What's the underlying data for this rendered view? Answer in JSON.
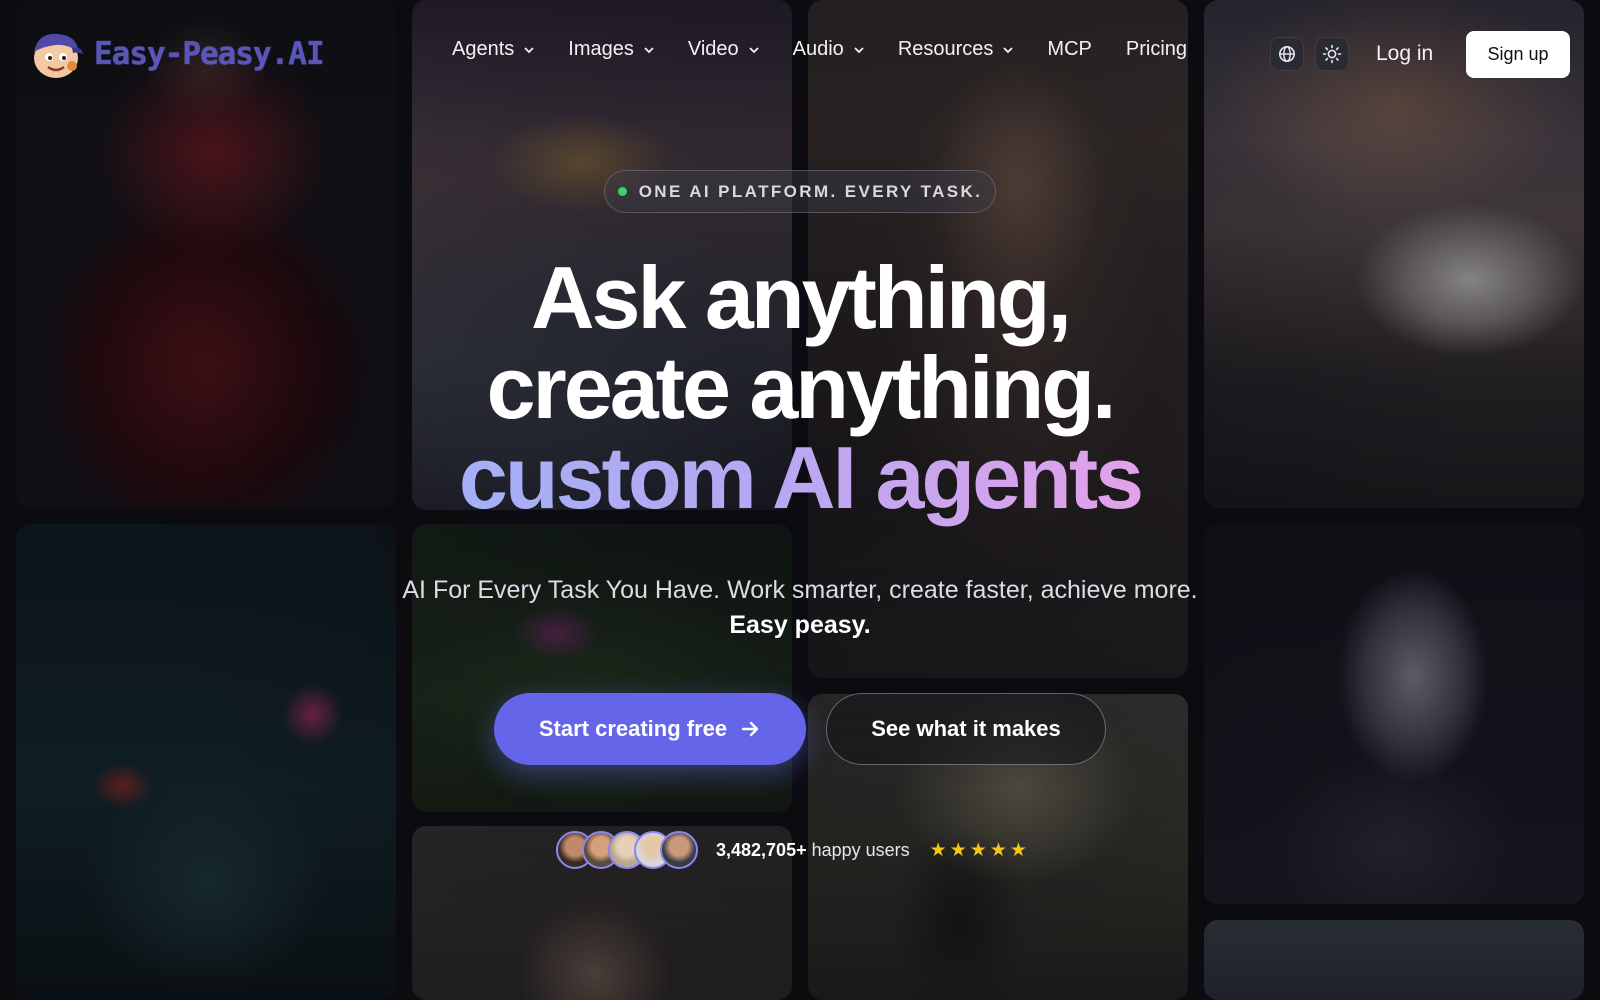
{
  "brand": {
    "name": "Easy-Peasy.AI"
  },
  "nav": {
    "menu": [
      {
        "label": "Agents",
        "dropdown": true
      },
      {
        "label": "Images",
        "dropdown": true
      },
      {
        "label": "Video",
        "dropdown": true
      },
      {
        "label": "Audio",
        "dropdown": true
      },
      {
        "label": "Resources",
        "dropdown": true
      },
      {
        "label": "MCP",
        "dropdown": false
      },
      {
        "label": "Pricing",
        "dropdown": false
      }
    ],
    "icons": [
      "globe-icon",
      "sun-icon"
    ],
    "login_label": "Log in",
    "signup_label": "Sign up"
  },
  "hero": {
    "badge": "ONE AI PLATFORM. EVERY TASK.",
    "headline_line1": "Ask anything,",
    "headline_line2": "create anything.",
    "headline_line3": "custom AI agents",
    "subtitle": "AI For Every Task You Have. Work smarter, create faster, achieve more.",
    "subtitle_strong": "Easy peasy.",
    "cta_primary": "Start creating free",
    "cta_secondary": "See what it makes",
    "user_count": "3,482,705+",
    "user_suffix": "happy users",
    "rating_stars": 5
  },
  "colors": {
    "accent": "#6465e8",
    "gradient_start": "#a5b0f6",
    "gradient_end": "#e2a2ea",
    "status_dot": "#39d36a",
    "star": "#f5c518"
  }
}
